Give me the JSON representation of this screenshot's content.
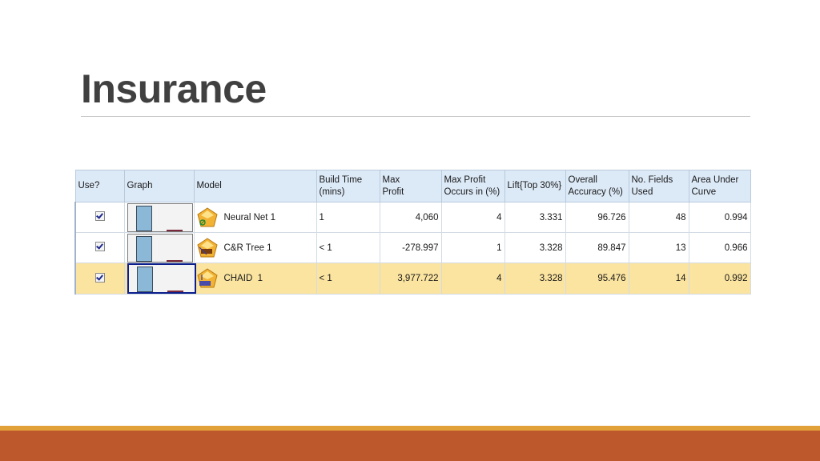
{
  "slide": {
    "title": "Insurance"
  },
  "table": {
    "headers": {
      "use": "Use?",
      "graph": "Graph",
      "model": "Model",
      "build_time_1": "Build Time",
      "build_time_2": "(mins)",
      "max_profit_1": "Max",
      "max_profit_2": "Profit",
      "max_profit_occurs_1": "Max Profit",
      "max_profit_occurs_2": "Occurs in (%)",
      "lift": "Lift{Top 30%}",
      "overall_accuracy_1": "Overall",
      "overall_accuracy_2": "Accuracy (%)",
      "fields_used_1": "No. Fields",
      "fields_used_2": "Used",
      "auc_1": "Area Under",
      "auc_2": "Curve"
    },
    "rows": [
      {
        "use": true,
        "model": "Neural Net 1",
        "icon": "neural-net-model-icon",
        "build_time": "1",
        "max_profit": "4,060",
        "max_profit_occurs": "4",
        "lift": "3.331",
        "overall_accuracy": "96.726",
        "fields_used": "48",
        "auc": "0.994",
        "selected": false
      },
      {
        "use": true,
        "model": "C&R Tree 1",
        "icon": "cr-tree-model-icon",
        "build_time": "< 1",
        "max_profit": "-278.997",
        "max_profit_occurs": "1",
        "lift": "3.328",
        "overall_accuracy": "89.847",
        "fields_used": "13",
        "auc": "0.966",
        "selected": false
      },
      {
        "use": true,
        "model": "CHAID  1",
        "icon": "chaid-model-icon",
        "build_time": "< 1",
        "max_profit": "3,977.722",
        "max_profit_occurs": "4",
        "lift": "3.328",
        "overall_accuracy": "95.476",
        "fields_used": "14",
        "auc": "0.992",
        "selected": true
      }
    ]
  },
  "colors": {
    "header_bg": "#dce9f7",
    "selected_row": "#fbe4a0",
    "footer_orange": "#bc582b",
    "footer_stripe": "#e3a13a"
  }
}
